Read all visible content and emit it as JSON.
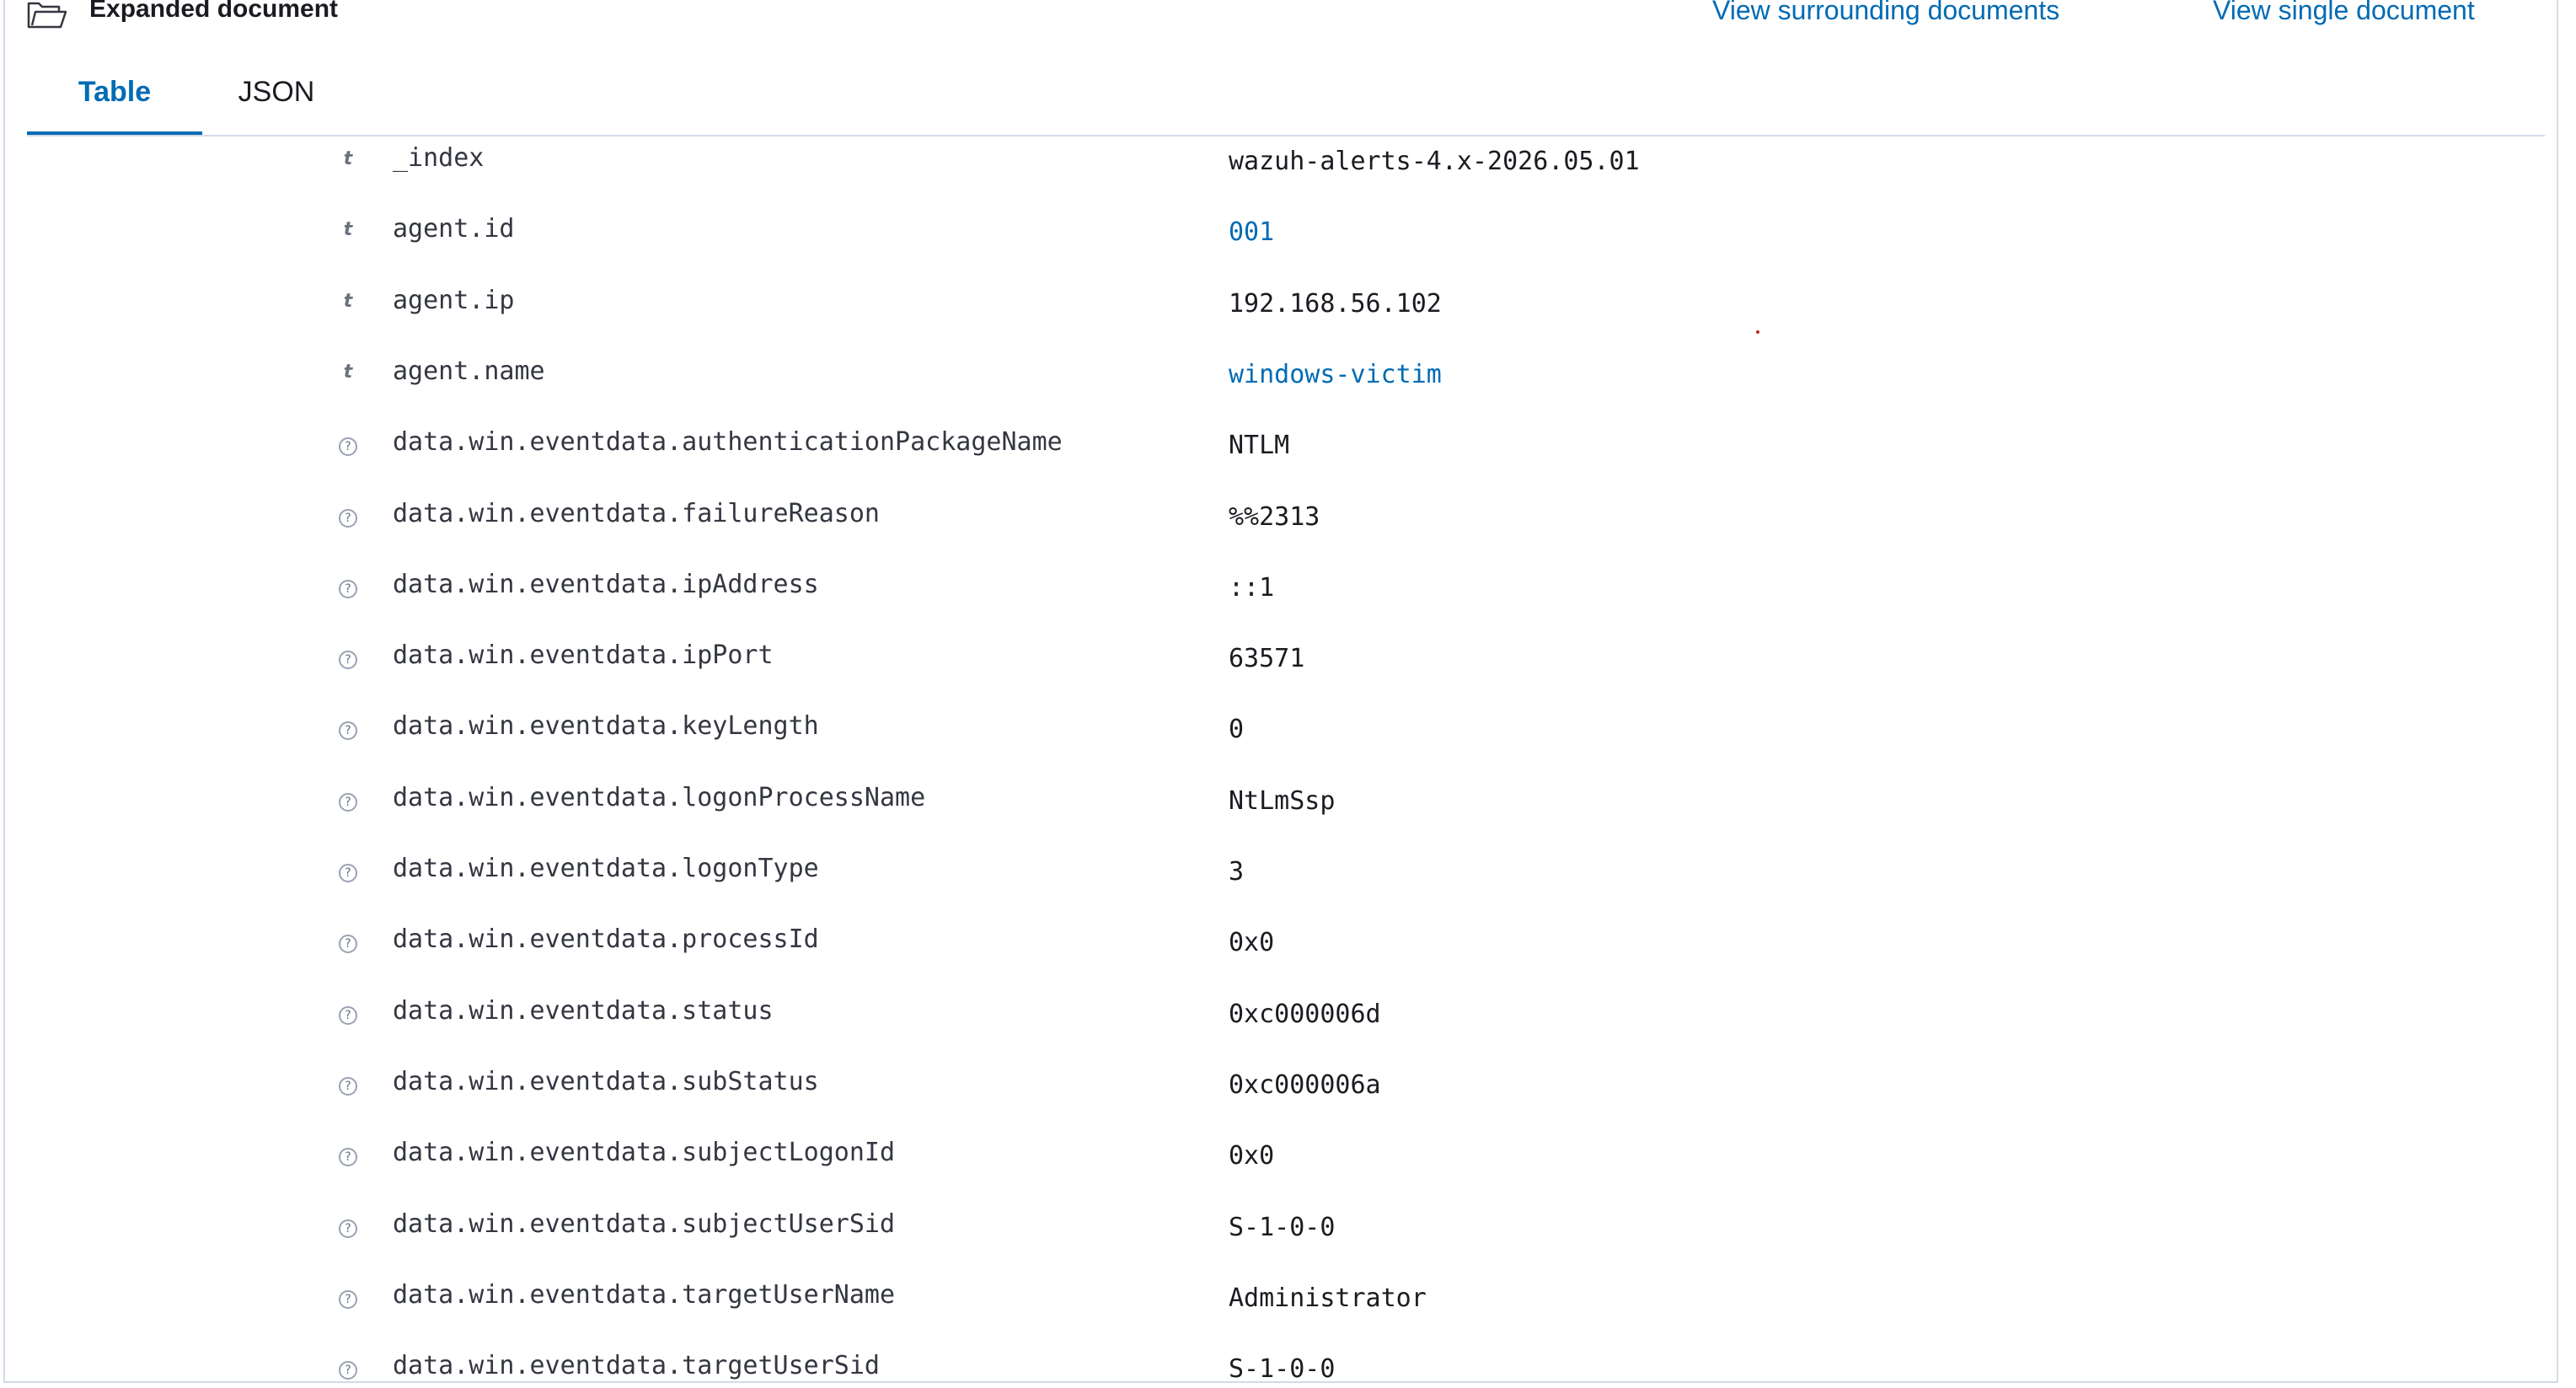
{
  "header": {
    "title": "Expanded document",
    "links": {
      "surrounding": "View surrounding documents",
      "single": "View single document"
    }
  },
  "tabs": [
    {
      "label": "Table",
      "active": true
    },
    {
      "label": "JSON",
      "active": false
    }
  ],
  "accent_color": "#006bb4",
  "fields": [
    {
      "type_icon": "string-type-icon",
      "name": "_index",
      "value": "wazuh-alerts-4.x-2026.05.01",
      "link": false
    },
    {
      "type_icon": "string-type-icon",
      "name": "agent.id",
      "value": "001",
      "link": true
    },
    {
      "type_icon": "string-type-icon",
      "name": "agent.ip",
      "value": "192.168.56.102",
      "link": false
    },
    {
      "type_icon": "string-type-icon",
      "name": "agent.name",
      "value": "windows-victim",
      "link": true
    },
    {
      "type_icon": "unknown-type-icon",
      "name": "data.win.eventdata.authenticationPackageName",
      "value": "NTLM",
      "link": false
    },
    {
      "type_icon": "unknown-type-icon",
      "name": "data.win.eventdata.failureReason",
      "value": "%%2313",
      "link": false
    },
    {
      "type_icon": "unknown-type-icon",
      "name": "data.win.eventdata.ipAddress",
      "value": "::1",
      "link": false
    },
    {
      "type_icon": "unknown-type-icon",
      "name": "data.win.eventdata.ipPort",
      "value": "63571",
      "link": false
    },
    {
      "type_icon": "unknown-type-icon",
      "name": "data.win.eventdata.keyLength",
      "value": "0",
      "link": false
    },
    {
      "type_icon": "unknown-type-icon",
      "name": "data.win.eventdata.logonProcessName",
      "value": "NtLmSsp",
      "link": false
    },
    {
      "type_icon": "unknown-type-icon",
      "name": "data.win.eventdata.logonType",
      "value": "3",
      "link": false
    },
    {
      "type_icon": "unknown-type-icon",
      "name": "data.win.eventdata.processId",
      "value": "0x0",
      "link": false
    },
    {
      "type_icon": "unknown-type-icon",
      "name": "data.win.eventdata.status",
      "value": "0xc000006d",
      "link": false
    },
    {
      "type_icon": "unknown-type-icon",
      "name": "data.win.eventdata.subStatus",
      "value": "0xc000006a",
      "link": false
    },
    {
      "type_icon": "unknown-type-icon",
      "name": "data.win.eventdata.subjectLogonId",
      "value": "0x0",
      "link": false
    },
    {
      "type_icon": "unknown-type-icon",
      "name": "data.win.eventdata.subjectUserSid",
      "value": "S-1-0-0",
      "link": false
    },
    {
      "type_icon": "unknown-type-icon",
      "name": "data.win.eventdata.targetUserName",
      "value": "Administrator",
      "link": false
    },
    {
      "type_icon": "unknown-type-icon",
      "name": "data.win.eventdata.targetUserSid",
      "value": "S-1-0-0",
      "link": false
    }
  ]
}
